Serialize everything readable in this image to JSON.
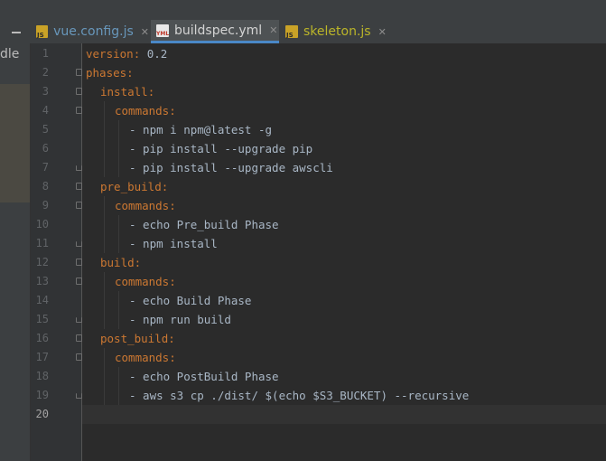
{
  "left_panel": {
    "partial_label": "dle"
  },
  "tabs": [
    {
      "label": "vue.config.js",
      "icon": "js-file-icon",
      "active": false
    },
    {
      "label": "buildspec.yml",
      "icon": "yml-file-icon",
      "active": true
    },
    {
      "label": "skeleton.js",
      "icon": "js-file-icon",
      "active": false
    }
  ],
  "editor": {
    "current_line": 20,
    "lines": [
      {
        "n": "1",
        "key": "version",
        "colon": ":",
        "value": " 0.2",
        "indent": 0
      },
      {
        "n": "2",
        "key": "phases",
        "colon": ":",
        "value": "",
        "indent": 0
      },
      {
        "n": "3",
        "key": "install",
        "colon": ":",
        "value": "",
        "indent": 1
      },
      {
        "n": "4",
        "key": "commands",
        "colon": ":",
        "value": "",
        "indent": 2
      },
      {
        "n": "5",
        "key": "",
        "colon": "",
        "value": "- npm i npm@latest -g",
        "indent": 3
      },
      {
        "n": "6",
        "key": "",
        "colon": "",
        "value": "- pip install --upgrade pip",
        "indent": 3
      },
      {
        "n": "7",
        "key": "",
        "colon": "",
        "value": "- pip install --upgrade awscli",
        "indent": 3
      },
      {
        "n": "8",
        "key": "pre_build",
        "colon": ":",
        "value": "",
        "indent": 1
      },
      {
        "n": "9",
        "key": "commands",
        "colon": ":",
        "value": "",
        "indent": 2
      },
      {
        "n": "10",
        "key": "",
        "colon": "",
        "value": "- echo Pre_build Phase",
        "indent": 3
      },
      {
        "n": "11",
        "key": "",
        "colon": "",
        "value": "- npm install",
        "indent": 3
      },
      {
        "n": "12",
        "key": "build",
        "colon": ":",
        "value": "",
        "indent": 1
      },
      {
        "n": "13",
        "key": "commands",
        "colon": ":",
        "value": "",
        "indent": 2
      },
      {
        "n": "14",
        "key": "",
        "colon": "",
        "value": "- echo Build Phase",
        "indent": 3
      },
      {
        "n": "15",
        "key": "",
        "colon": "",
        "value": "- npm run build",
        "indent": 3
      },
      {
        "n": "16",
        "key": "post_build",
        "colon": ":",
        "value": "",
        "indent": 1
      },
      {
        "n": "17",
        "key": "commands",
        "colon": ":",
        "value": "",
        "indent": 2
      },
      {
        "n": "18",
        "key": "",
        "colon": "",
        "value": "- echo PostBuild Phase",
        "indent": 3
      },
      {
        "n": "19",
        "key": "",
        "colon": "",
        "value": "- aws s3 cp ./dist/ $(echo $S3_BUCKET) --recursive",
        "indent": 3
      },
      {
        "n": "20",
        "key": "",
        "colon": "",
        "value": "",
        "indent": 0
      }
    ]
  },
  "colors": {
    "background": "#2b2b2b",
    "key": "#cc7832",
    "text": "#a9b7c6",
    "line_number": "#606366",
    "active_tab_underline": "#4a88c7"
  }
}
